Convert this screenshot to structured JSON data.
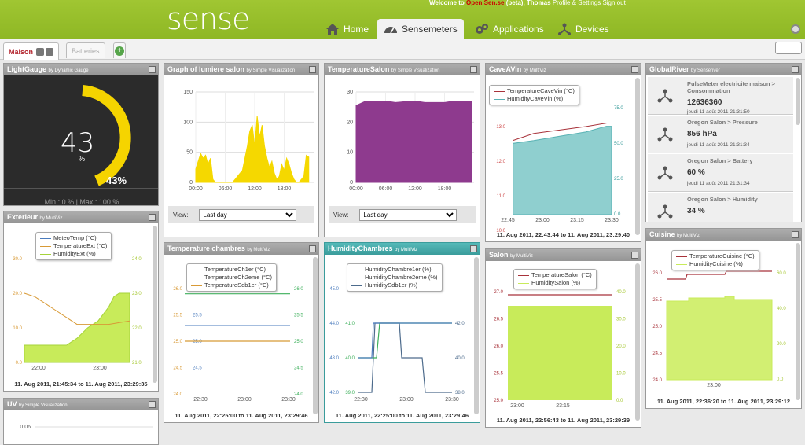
{
  "header": {
    "logo": "sense",
    "welcome_prefix": "Welcome to",
    "site_name": "Open.Sen.se",
    "welcome_suffix": "(beta), Thomas",
    "profile_link": "Profile & Settings",
    "signout_link": "Sign out",
    "nav": [
      {
        "label": "Home",
        "icon": "home-icon",
        "active": false
      },
      {
        "label": "Sensemeters",
        "icon": "speedometer-icon",
        "active": true
      },
      {
        "label": "Applications",
        "icon": "gears-icon",
        "active": false
      },
      {
        "label": "Devices",
        "icon": "devices-icon",
        "active": false
      }
    ]
  },
  "tabs": [
    {
      "label": "Maison",
      "selected": true
    },
    {
      "label": "Batteries",
      "selected": false
    }
  ],
  "widgets": {
    "lightgauge": {
      "title": "LightGauge",
      "by": "by Dynamic Gauge",
      "value": "43",
      "unit": "%",
      "value_label": "43%",
      "percent": 43,
      "minmax": "Min : 0 % | Max : 100 %"
    },
    "lumiere": {
      "title": "Graph of lumiere salon",
      "by": "by Simple Visualization",
      "view_label": "View:",
      "view_value": "Last day",
      "chart_data": {
        "type": "area",
        "y_ticks": [
          "150",
          "100",
          "50",
          "0"
        ],
        "x_ticks": [
          "00:00",
          "06:00",
          "12:00",
          "18:00"
        ],
        "ylim": [
          0,
          150
        ],
        "x": [
          0,
          0.5,
          1,
          1.5,
          2,
          2.5,
          3,
          3.5,
          4,
          4.5,
          5,
          5.5,
          6,
          6.5,
          7,
          7.5,
          8,
          8.5,
          9,
          9.5,
          10,
          10.5,
          11,
          11.5,
          12,
          12.5,
          13,
          13.5,
          14,
          14.5,
          15,
          15.5,
          16,
          16.5,
          17,
          17.5,
          18,
          18.5,
          19,
          19.5,
          20,
          20.5,
          21,
          21.5,
          22,
          22.5,
          23
        ],
        "y": [
          22,
          35,
          48,
          40,
          45,
          30,
          40,
          5,
          0,
          0,
          0,
          0,
          0,
          0,
          0,
          0,
          5,
          10,
          15,
          20,
          40,
          60,
          85,
          95,
          60,
          110,
          75,
          95,
          60,
          40,
          25,
          35,
          15,
          5,
          10,
          30,
          20,
          40,
          30,
          15,
          5,
          0,
          0,
          5,
          10,
          45,
          42
        ],
        "color": "#f5d800"
      }
    },
    "tempsalon": {
      "title": "TemperatureSalon",
      "by": "by Simple Visualization",
      "view_label": "View:",
      "view_value": "Last day",
      "chart_data": {
        "type": "area",
        "y_ticks": [
          "30",
          "20",
          "10",
          "0"
        ],
        "x_ticks": [
          "00:00",
          "06:00",
          "12:00",
          "18:00"
        ],
        "ylim": [
          0,
          30
        ],
        "x": [
          0,
          2,
          4,
          6,
          8,
          10,
          12,
          14,
          16,
          18,
          20,
          22,
          23.5
        ],
        "y": [
          25.5,
          27,
          26.8,
          27,
          26.5,
          26.8,
          27,
          26.5,
          26.5,
          26.5,
          27,
          27,
          27
        ],
        "color": "#8e3a8e"
      }
    },
    "caveavin": {
      "title": "CaveAVin",
      "by": "by MultiViz",
      "legend": [
        "TemperatureCaveVin (°C)",
        "HumidityCaveVin (%)"
      ],
      "colors": [
        "#a8323a",
        "#58b2b4"
      ],
      "footer": "11. Aug 2011, 22:43:44 to 11. Aug 2011, 23:29:40",
      "chart_data": {
        "type": "line",
        "x_ticks": [
          "22:45",
          "23:00",
          "23:15",
          "23:30"
        ],
        "y_left_ticks": [
          "14.0",
          "13.0",
          "12.0",
          "11.0",
          "10.0"
        ],
        "y_right_ticks": [
          "75.0",
          "50.0",
          "25.0",
          "0.0"
        ],
        "series": [
          {
            "name": "TemperatureCaveVin (°C)",
            "x": [
              0.05,
              0.25,
              0.5,
              0.75,
              0.95
            ],
            "y": [
              12.6,
              12.8,
              12.9,
              13.0,
              13.1
            ]
          },
          {
            "name": "HumidityCaveVin (%)",
            "x": [
              0.05,
              0.25,
              0.5,
              0.75,
              0.95
            ],
            "y": [
              50,
              52,
              55,
              58,
              62
            ]
          }
        ]
      }
    },
    "globalriver": {
      "title": "GlobalRiver",
      "by": "by Senseriver",
      "items": [
        {
          "title": "PulseMeter electricite maison > Consommation",
          "value": "12636360",
          "time": "jeudi 11 août 2011 21:31:50"
        },
        {
          "title": "Oregon Salon > Pressure",
          "value": "856 hPa",
          "time": "jeudi 11 août 2011 21:31:34"
        },
        {
          "title": "Oregon Salon > Battery",
          "value": "60 %",
          "time": "jeudi 11 août 2011 21:31:34"
        },
        {
          "title": "Oregon Salon > Humidity",
          "value": "34 %",
          "time": ""
        }
      ]
    },
    "exterieur": {
      "title": "Exterieur",
      "by": "by MultiViz",
      "legend": [
        "MeteoTemp (°C)",
        "TemperatureExt (°C)",
        "HumidityExt (%)"
      ],
      "colors": [
        "#4a7bbd",
        "#d89a36",
        "#a6d33a"
      ],
      "footer": "11. Aug 2011, 21:45:34 to 11. Aug 2011, 23:29:35",
      "chart_data": {
        "type": "line",
        "x_ticks": [
          "22:00",
          "23:00"
        ],
        "y_left_ticks": [
          "30.0",
          "20.0",
          "10.0",
          "0.0"
        ],
        "y_right_ticks": [
          "24.0",
          "23.0",
          "22.0",
          "21.0"
        ],
        "series": [
          {
            "name": "TemperatureExt (°C)",
            "x": [
              0,
              0.1,
              0.2,
              0.3,
              0.4,
              0.5,
              0.6,
              0.7,
              0.8,
              0.9,
              1
            ],
            "y": [
              20,
              19,
              17,
              15,
              13,
              11,
              11,
              11,
              11,
              11.5,
              12
            ]
          },
          {
            "name": "HumidityExt (%)",
            "x": [
              0,
              0.4,
              0.5,
              0.6,
              0.7,
              0.75,
              0.8,
              0.85,
              0.9,
              1
            ],
            "y": [
              21.5,
              21.5,
              21.7,
              22.0,
              22.2,
              22.4,
              22.6,
              22.9,
              23.0,
              23.0
            ]
          }
        ]
      }
    },
    "chambres": {
      "title": "Temperature chambres",
      "by": "by MultiViz",
      "legend": [
        "TemperatureCh1er (°C)",
        "TemperatureCh2eme (°C)",
        "TemperatureSdb1er (°C)"
      ],
      "colors": [
        "#4a7bbd",
        "#3caf5a",
        "#d89a36"
      ],
      "footer": "11. Aug 2011, 22:25:00 to 11. Aug 2011, 23:29:46",
      "chart_data": {
        "type": "line",
        "x_ticks": [
          "22:30",
          "23:00",
          "23:30"
        ],
        "y_left_ticks": [
          "26.0",
          "25.5",
          "25.0",
          "24.5",
          "24.0"
        ],
        "y_right_ticks": [
          "26.0",
          "25.5",
          "25.0",
          "24.5",
          "24.0"
        ],
        "series": [
          {
            "name": "TemperatureCh1er (°C)",
            "y": [
              25.3
            ]
          },
          {
            "name": "TemperatureCh2eme (°C)",
            "y": [
              25.9
            ]
          },
          {
            "name": "TemperatureSdb1er (°C)",
            "y": [
              25.0
            ]
          }
        ]
      }
    },
    "humidity": {
      "title": "HumidityChambres",
      "by": "by MultiViz",
      "legend": [
        "HumidityChambre1er (%)",
        "HumidityChambre2eme (%)",
        "HumiditySdb1er (%)"
      ],
      "colors": [
        "#4a7bbd",
        "#3caf5a",
        "#4d6b8c"
      ],
      "footer": "11. Aug 2011, 22:25:00 to 11. Aug 2011, 23:29:46",
      "chart_data": {
        "type": "line",
        "x_ticks": [
          "22:30",
          "23:00",
          "23:30"
        ],
        "y_left_ticks": [
          "45.0",
          "44.0",
          "43.0",
          "42.0"
        ],
        "y_mid_ticks": [
          "41.0",
          "40.0",
          "39.0"
        ],
        "y_right_ticks": [
          "42.0",
          "40.0",
          "38.0"
        ]
      }
    },
    "salon": {
      "title": "Salon",
      "by": "by MultiViz",
      "legend": [
        "TemperatureSalon (°C)",
        "HumiditySalon (%)"
      ],
      "colors": [
        "#a8323a",
        "#c8eb5a"
      ],
      "footer": "11. Aug 2011, 22:56:43 to 11. Aug 2011, 23:29:39",
      "chart_data": {
        "type": "line",
        "x_ticks": [
          "23:00",
          "23:15"
        ],
        "y_left_ticks": [
          "27.0",
          "26.5",
          "26.0",
          "25.5",
          "25.0"
        ],
        "y_right_ticks": [
          "40.0",
          "30.0",
          "20.0",
          "10.0",
          "0.0"
        ],
        "series": [
          {
            "name": "TemperatureSalon (°C)",
            "y": [
              26.9
            ]
          },
          {
            "name": "HumiditySalon (%)",
            "y": [
              34
            ]
          }
        ]
      }
    },
    "cuisine": {
      "title": "Cuisine",
      "by": "by MultiViz",
      "legend": [
        "TemperatureCuisine (°C)",
        "HumidityCuisine (%)"
      ],
      "colors": [
        "#a8323a",
        "#c8eb5a"
      ],
      "footer": "11. Aug 2011, 22:36:20 to 11. Aug 2011, 23:29:12",
      "chart_data": {
        "type": "line",
        "x_ticks": [
          "23:00"
        ],
        "y_left_ticks": [
          "26.0",
          "25.5",
          "25.0",
          "24.5",
          "24.0"
        ],
        "y_right_ticks": [
          "60.0",
          "40.0",
          "20.0",
          "0.0"
        ]
      }
    },
    "uv": {
      "title": "UV",
      "by": "by Simple Visualization",
      "chart_data": {
        "type": "line",
        "y_ticks": [
          "0.06"
        ]
      }
    }
  }
}
